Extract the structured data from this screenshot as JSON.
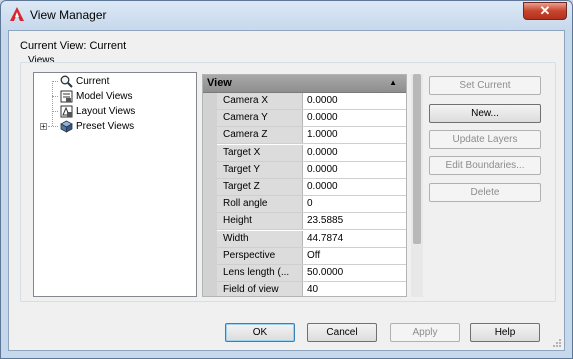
{
  "window": {
    "title": "View Manager",
    "close_icon": "close-icon"
  },
  "current_view_label": "Current View: Current",
  "views_group_label": "Views",
  "tree": {
    "items": [
      {
        "label": "Current",
        "icon": "magnifier-icon"
      },
      {
        "label": "Model Views",
        "icon": "model-views-icon"
      },
      {
        "label": "Layout Views",
        "icon": "layout-views-icon"
      },
      {
        "label": "Preset Views",
        "icon": "preset-views-icon",
        "expander": "+"
      }
    ]
  },
  "properties": {
    "section_title": "View",
    "collapse_arrow": "▲",
    "rows": [
      {
        "name": "Camera X",
        "value": "0.0000"
      },
      {
        "name": "Camera Y",
        "value": "0.0000"
      },
      {
        "name": "Camera Z",
        "value": "1.0000"
      },
      {
        "name": "Target X",
        "value": "0.0000"
      },
      {
        "name": "Target Y",
        "value": "0.0000"
      },
      {
        "name": "Target Z",
        "value": "0.0000"
      },
      {
        "name": "Roll angle",
        "value": "0"
      },
      {
        "name": "Height",
        "value": "23.5885"
      },
      {
        "name": "Width",
        "value": "44.7874"
      },
      {
        "name": "Perspective",
        "value": "Off"
      },
      {
        "name": "Lens length (...",
        "value": "50.0000"
      },
      {
        "name": "Field of view",
        "value": "40"
      }
    ]
  },
  "side_buttons": {
    "set_current": "Set Current",
    "new": "New...",
    "update_layers": "Update Layers",
    "edit_boundaries": "Edit Boundaries...",
    "delete": "Delete"
  },
  "bottom_buttons": {
    "ok": "OK",
    "cancel": "Cancel",
    "apply": "Apply",
    "help": "Help"
  }
}
